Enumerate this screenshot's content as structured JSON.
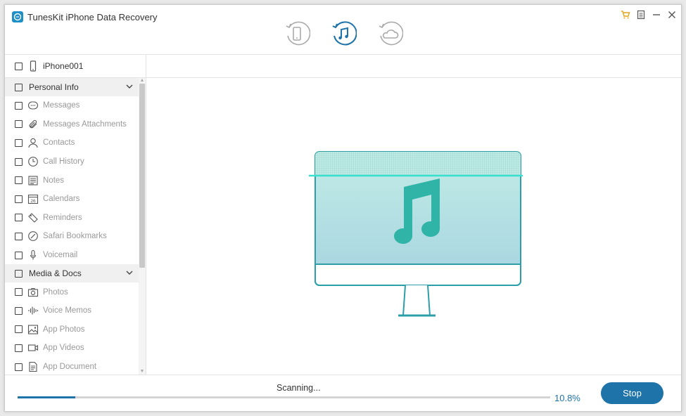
{
  "app": {
    "title": "TunesKit iPhone Data Recovery"
  },
  "modes": [
    {
      "name": "recover-from-device",
      "icon": "phone-restore-icon"
    },
    {
      "name": "recover-from-itunes",
      "icon": "music-restore-icon"
    },
    {
      "name": "recover-from-icloud",
      "icon": "cloud-restore-icon"
    }
  ],
  "colors": {
    "accent": "#1e73a8",
    "teal": "#2fb4a7"
  },
  "sidebar": {
    "device": "iPhone001",
    "groups": [
      {
        "label": "Personal Info",
        "items": [
          {
            "label": "Messages",
            "icon": "message-icon"
          },
          {
            "label": "Messages Attachments",
            "icon": "paperclip-icon"
          },
          {
            "label": "Contacts",
            "icon": "contact-icon"
          },
          {
            "label": "Call History",
            "icon": "clock-icon"
          },
          {
            "label": "Notes",
            "icon": "notes-icon"
          },
          {
            "label": "Calendars",
            "icon": "calendar-icon"
          },
          {
            "label": "Reminders",
            "icon": "reminder-icon"
          },
          {
            "label": "Safari Bookmarks",
            "icon": "compass-icon"
          },
          {
            "label": "Voicemail",
            "icon": "microphone-icon"
          }
        ]
      },
      {
        "label": "Media & Docs",
        "items": [
          {
            "label": "Photos",
            "icon": "camera-icon"
          },
          {
            "label": "Voice Memos",
            "icon": "waveform-icon"
          },
          {
            "label": "App Photos",
            "icon": "image-icon"
          },
          {
            "label": "App Videos",
            "icon": "video-icon"
          },
          {
            "label": "App Document",
            "icon": "document-icon"
          }
        ]
      }
    ]
  },
  "calendar_day": "26",
  "scan": {
    "status": "Scanning...",
    "percent_label": "10.8%",
    "progress": 0.108
  },
  "actions": {
    "stop": "Stop"
  }
}
